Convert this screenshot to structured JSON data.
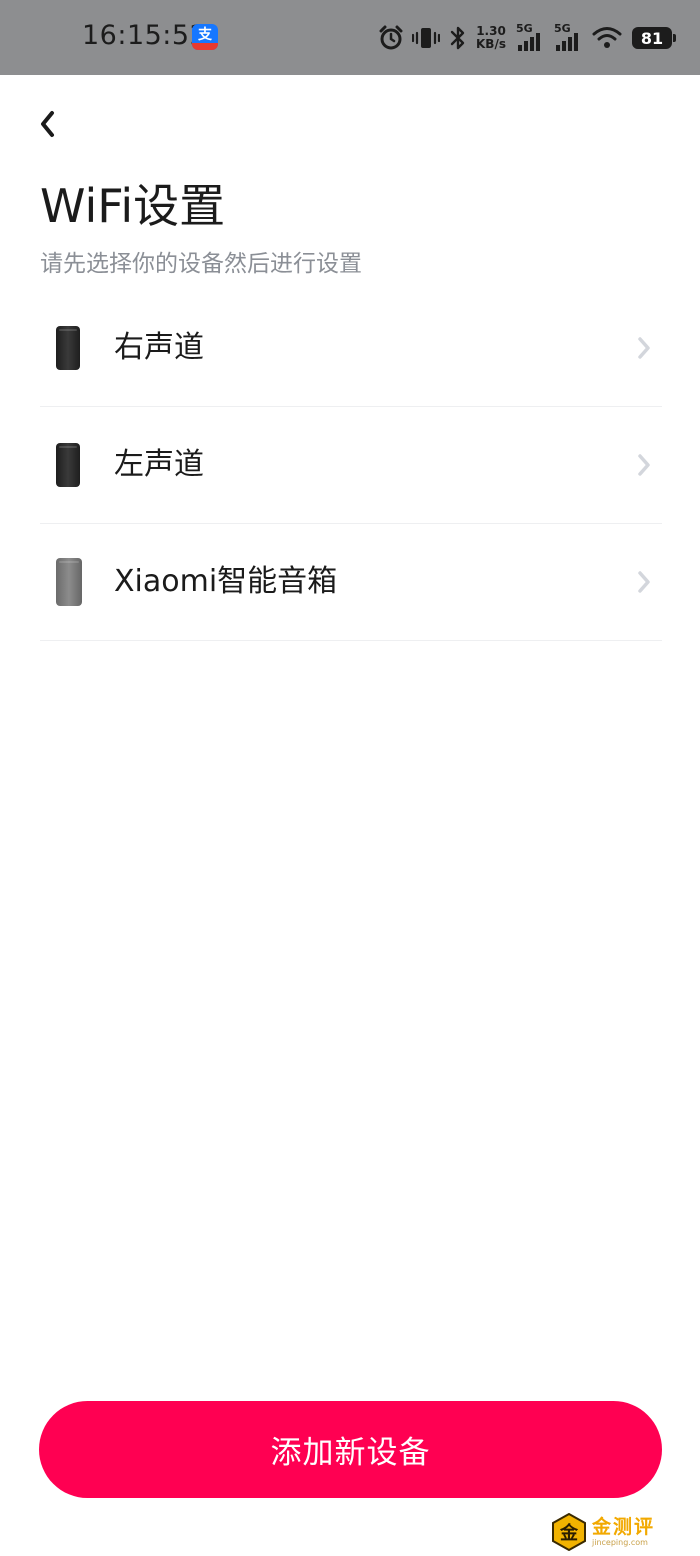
{
  "status_bar": {
    "time": "16:15:52",
    "app_badge_char": "支",
    "net_speed_value": "1.30",
    "net_speed_unit": "KB/s",
    "sim1_tag": "5G",
    "sim2_tag": "5G",
    "battery": "81",
    "icons": [
      "alarm-icon",
      "vibrate-icon",
      "bluetooth-icon",
      "signal-icon",
      "signal-icon",
      "wifi-icon",
      "battery-icon"
    ]
  },
  "header": {
    "back_icon": "chevron-left-icon",
    "title": "WiFi设置",
    "subtitle": "请先选择你的设备然后进行设置"
  },
  "devices": [
    {
      "name": "右声道",
      "icon": "speaker-black-icon"
    },
    {
      "name": "左声道",
      "icon": "speaker-black-icon"
    },
    {
      "name": "Xiaomi智能音箱",
      "icon": "speaker-grey-icon"
    }
  ],
  "footer": {
    "add_button_label": "添加新设备"
  },
  "watermark": {
    "badge_char": "金",
    "name": "金测评",
    "url": "jinceping.com"
  },
  "colors": {
    "accent": "#ff0052",
    "status_bar_bg": "#8d8e90",
    "subtitle": "#8b8f96",
    "chevron": "#d3d6dc",
    "divider": "#eeeff1"
  }
}
